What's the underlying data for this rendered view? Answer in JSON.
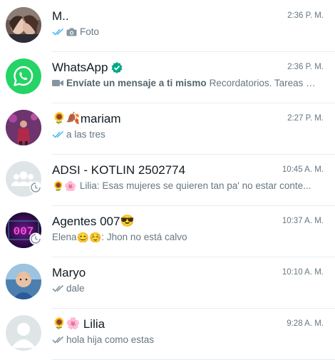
{
  "chats": [
    {
      "name": "M..",
      "time": "2:36 P. M.",
      "preview": "Foto",
      "status": "read",
      "icon": "camera-icon"
    },
    {
      "name": "WhatsApp",
      "verified": true,
      "time": "2:36 P. M.",
      "preview_bold": "Envíate un mensaje a ti mismo",
      "preview": "Recordatorios. Tareas p...",
      "icon": "video-icon"
    },
    {
      "name": "mariam",
      "name_emoji": "🌻🍂",
      "time": "2:27 P. M.",
      "preview": "a las tres",
      "status": "read"
    },
    {
      "name": "ADSI - KOTLIN 2502774",
      "time": "10:45 A. M.",
      "preview_emoji": "🌻🌸",
      "preview": "Lilia: Esas mujeres se quieren tan pa' no estar conte..."
    },
    {
      "name": "Agentes 007",
      "name_emoji_after": "😎",
      "avatar_text": "007",
      "time": "10:37 A. M.",
      "preview_prefix": "Elena",
      "preview_emoji": "😊☺️",
      "preview": ": Jhon no está calvo"
    },
    {
      "name": "Maryo",
      "time": "10:10 A. M.",
      "preview": "dale",
      "status": "delivered"
    },
    {
      "name": "Lilia",
      "name_emoji": "🌻🌸",
      "time": "9:28 A. M.",
      "preview": "hola hija como estas",
      "status": "delivered"
    }
  ],
  "colors": {
    "read_ticks": "#53bdeb",
    "delivered_ticks": "#8696a0",
    "whatsapp_green": "#25d366",
    "verified_green": "#00a884"
  }
}
